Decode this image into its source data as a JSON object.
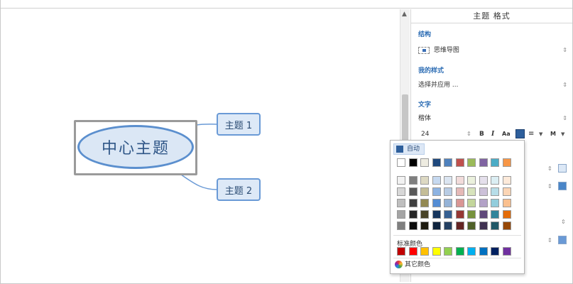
{
  "canvas": {
    "central_topic": "中心主题",
    "topics": [
      "主题 1",
      "主题 2"
    ]
  },
  "panel": {
    "title": "主题 格式",
    "structure": {
      "label": "结构",
      "value": "思维导图"
    },
    "my_style": {
      "label": "我的样式",
      "value": "选择并应用 ..."
    },
    "text": {
      "label": "文字",
      "font": "楷体",
      "size": "24",
      "bold": "B",
      "italic": "I",
      "case": "Aa",
      "align_icon": "align-center-icon",
      "more": "M"
    },
    "side_colors": [
      "#dce8f6",
      "#4a86c8",
      "#6a9ad6"
    ]
  },
  "color_popup": {
    "auto_label": "自动",
    "auto_color": "#2e5f9c",
    "theme_top": [
      "#ffffff",
      "#000000",
      "#eeece1",
      "#1f497d",
      "#4f81bd",
      "#c0504d",
      "#9bbb59",
      "#8064a2",
      "#4bacc6",
      "#f79646"
    ],
    "theme_grid": [
      [
        "#f2f2f2",
        "#7f7f7f",
        "#ddd9c3",
        "#c6d9f0",
        "#dbe5f1",
        "#f2dcdb",
        "#ebf1dd",
        "#e5e0ec",
        "#dbeef3",
        "#fdeada"
      ],
      [
        "#d8d8d8",
        "#595959",
        "#c4bd97",
        "#8db3e2",
        "#b8cce4",
        "#e5b9b7",
        "#d7e3bc",
        "#ccc1d9",
        "#b7dde8",
        "#fbd5b5"
      ],
      [
        "#bfbfbf",
        "#3f3f3f",
        "#938953",
        "#548dd4",
        "#95b3d7",
        "#d99694",
        "#c3d69b",
        "#b2a2c7",
        "#92cddc",
        "#fac08f"
      ],
      [
        "#a5a5a5",
        "#262626",
        "#494429",
        "#17365d",
        "#366092",
        "#953734",
        "#76923c",
        "#5f497a",
        "#31859b",
        "#e36c09"
      ],
      [
        "#7f7f7f",
        "#0c0c0c",
        "#1d1b10",
        "#0f243e",
        "#244061",
        "#632423",
        "#4f6128",
        "#3f3151",
        "#205867",
        "#974806"
      ]
    ],
    "standard_label": "标准颜色",
    "standard": [
      "#c00000",
      "#ff0000",
      "#ffc000",
      "#ffff00",
      "#92d050",
      "#00b050",
      "#00b0f0",
      "#0070c0",
      "#002060",
      "#7030a0"
    ],
    "other_label": "其它颜色"
  }
}
